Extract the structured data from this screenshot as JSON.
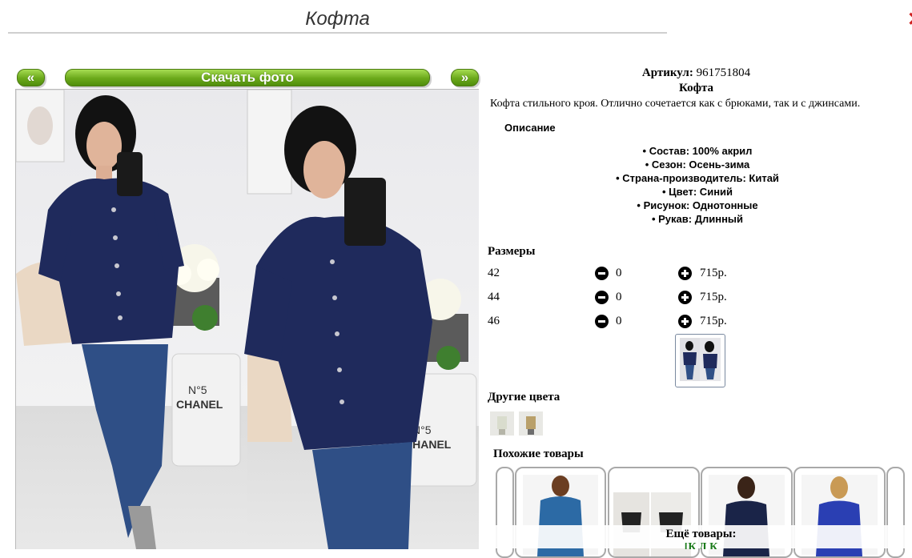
{
  "header": {
    "title": "Кофта",
    "close_glyph": "✕"
  },
  "gallery": {
    "prev_label": "«",
    "download_label": "Скачать фото",
    "next_label": "»"
  },
  "product": {
    "sku_label": "Артикул:",
    "sku_value": "961751804",
    "name": "Кофта",
    "description": "Кофта стильного кроя. Отлично сочетается как с брюками, так и с джинсами.",
    "description_title": "Описание",
    "properties": [
      "Состав: 100% акрил",
      "Сезон: Осень-зима",
      "Страна-производитель: Китай",
      "Цвет: Синий",
      "Рисунок: Однотонные",
      "Рукав: Длинный"
    ]
  },
  "sizes": {
    "title": "Размеры",
    "rows": [
      {
        "size": "42",
        "qty": "0",
        "price": "715р."
      },
      {
        "size": "44",
        "qty": "0",
        "price": "715р."
      },
      {
        "size": "46",
        "qty": "0",
        "price": "715р."
      }
    ]
  },
  "other_colors": {
    "title": "Другие цвета"
  },
  "similar": {
    "title": "Похожие товары"
  },
  "more": {
    "title": "Ещё товары:",
    "links_text": "[К                                    Д                                 К"
  },
  "colors": {
    "accent_green": "#6aa81a",
    "sweater_navy": "#1f2a5c",
    "jeans_blue": "#2f4f86"
  }
}
